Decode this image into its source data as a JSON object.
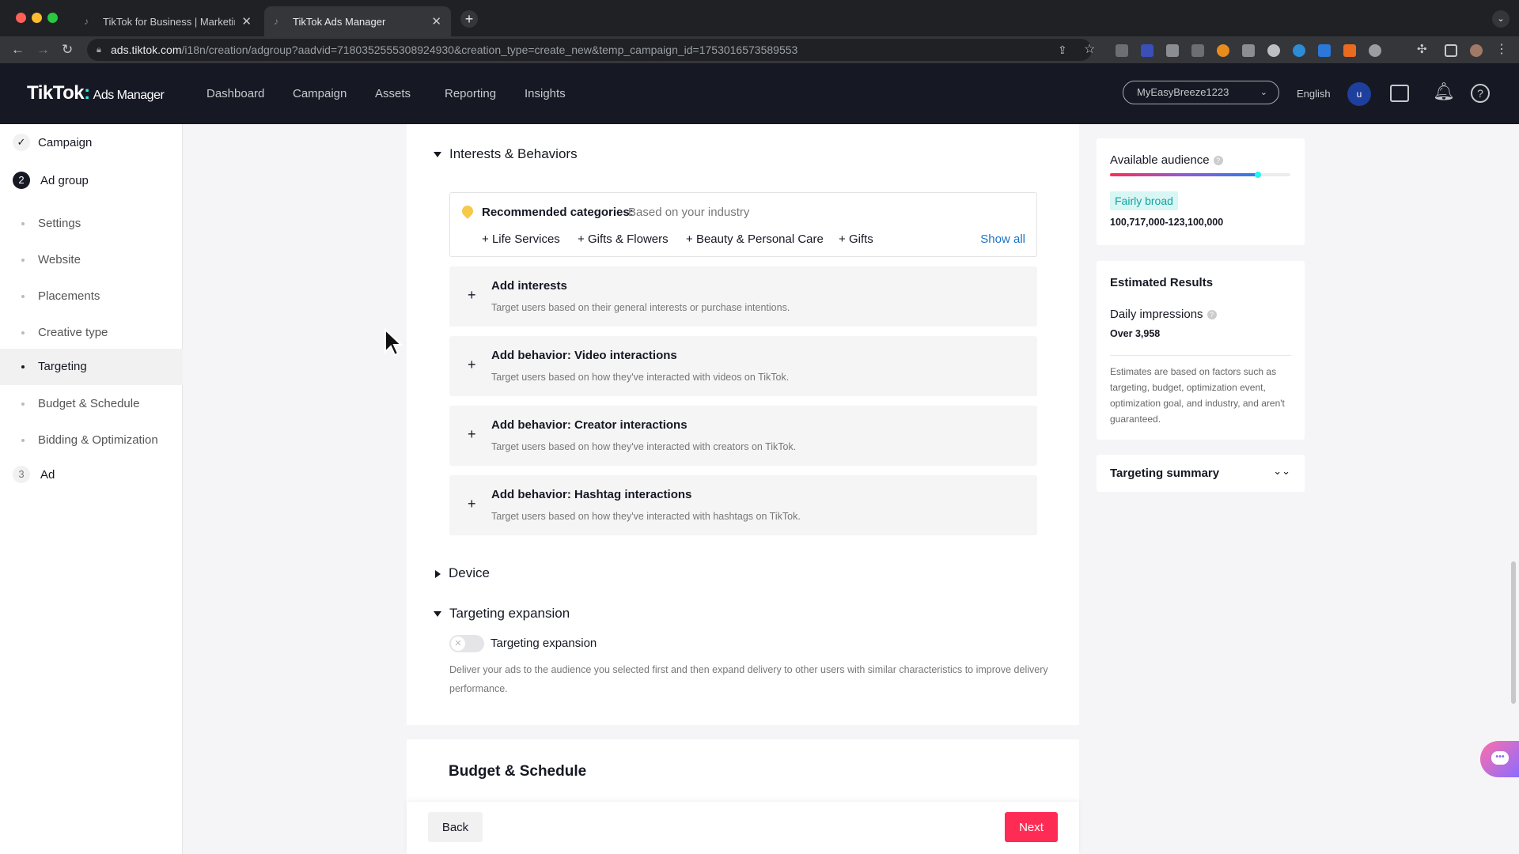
{
  "browser": {
    "tabs": [
      {
        "title": "TikTok for Business | Marketing"
      },
      {
        "title": "TikTok Ads Manager"
      }
    ],
    "url_host": "ads.tiktok.com",
    "url_path": "/i18n/creation/adgroup?aadvid=7180352555308924930&creation_type=create_new&temp_campaign_id=1753016573589553"
  },
  "header": {
    "logo": "TikTok",
    "logo_sub": "Ads Manager",
    "nav": [
      "Dashboard",
      "Campaign",
      "Assets",
      "Reporting",
      "Insights"
    ],
    "account": "MyEasyBreeze1223",
    "language": "English",
    "avatar": "u"
  },
  "sidebar": {
    "steps": [
      {
        "num": "✓",
        "label": "Campaign"
      },
      {
        "num": "2",
        "label": "Ad group"
      },
      {
        "num": "3",
        "label": "Ad"
      }
    ],
    "items": [
      "Settings",
      "Website",
      "Placements",
      "Creative type",
      "Targeting",
      "Budget & Schedule",
      "Bidding & Optimization"
    ],
    "selected": "Targeting"
  },
  "main": {
    "interests_title": "Interests & Behaviors",
    "reco_label": "Recommended categories:",
    "reco_sub": "Based on your industry",
    "reco_chips": [
      "Life Services",
      "Gifts & Flowers",
      "Beauty & Personal Care",
      "Gifts"
    ],
    "show_all": "Show all",
    "cards": [
      {
        "title": "Add interests",
        "desc": "Target users based on their general interests or purchase intentions."
      },
      {
        "title": "Add behavior: Video interactions",
        "desc": "Target users based on how they've interacted with videos on TikTok."
      },
      {
        "title": "Add behavior: Creator interactions",
        "desc": "Target users based on how they've interacted with creators on TikTok."
      },
      {
        "title": "Add behavior: Hashtag interactions",
        "desc": "Target users based on how they've interacted with hashtags on TikTok."
      }
    ],
    "device_title": "Device",
    "expansion_title": "Targeting expansion",
    "expansion_toggle_label": "Targeting expansion",
    "expansion_enabled": false,
    "expansion_desc": "Deliver your ads to the audience you selected first and then expand delivery to other users with similar characteristics to improve delivery performance.",
    "budget_title": "Budget & Schedule",
    "back": "Back",
    "next": "Next"
  },
  "right": {
    "audience_title": "Available audience",
    "audience_level": 0.82,
    "audience_badge": "Fairly broad",
    "audience_range": "100,717,000-123,100,000",
    "est_title": "Estimated Results",
    "daily_label": "Daily impressions",
    "daily_value": "Over 3,958",
    "est_note": "Estimates are based on factors such as targeting, budget, optimization event, optimization goal, and industry, and aren't guaranteed.",
    "summary_title": "Targeting summary"
  }
}
